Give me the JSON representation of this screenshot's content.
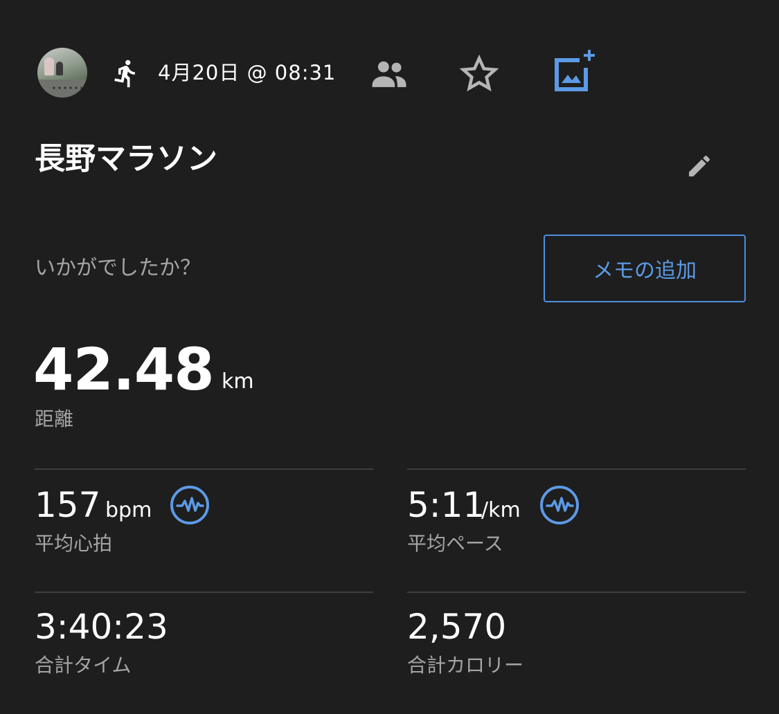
{
  "header": {
    "date_time": "4月20日 @ 08:31",
    "icons": {
      "activity": "running-icon",
      "privacy": "people-icon",
      "favorite": "star-icon",
      "add_photo": "add-photo-icon"
    }
  },
  "activity": {
    "title": "長野マラソン",
    "edit_icon": "pencil-icon"
  },
  "memo": {
    "question": "いかがでしたか？",
    "button_label": "メモの追加"
  },
  "distance": {
    "value": "42.48",
    "unit": "km",
    "label": "距離"
  },
  "stats": {
    "heart_rate": {
      "value": "157",
      "unit": "bpm",
      "label": "平均心拍",
      "icon": "heart-rate-wave-icon"
    },
    "pace": {
      "value": "5:11",
      "unit": "/km",
      "label": "平均ペース",
      "icon": "pace-wave-icon"
    },
    "total_time": {
      "value": "3:40:23",
      "label": "合計タイム"
    },
    "calories": {
      "value": "2,570",
      "label": "合計カロリー"
    }
  },
  "colors": {
    "background": "#1e1e1e",
    "accent": "#5c9ae6",
    "secondary_text": "#a5a5a5",
    "divider": "#3d3d3d"
  }
}
